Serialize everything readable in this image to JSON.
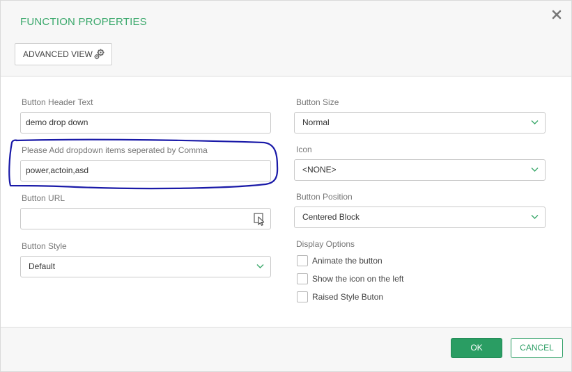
{
  "dialog": {
    "title": "FUNCTION PROPERTIES",
    "advanced_view_label": "ADVANCED VIEW"
  },
  "fields": {
    "button_header_text": {
      "label": "Button Header Text",
      "value": "demo drop down"
    },
    "dropdown_items": {
      "label": "Please Add dropdown items seperated by Comma",
      "value": "power,actoin,asd"
    },
    "button_url": {
      "label": "Button URL",
      "value": ""
    },
    "button_style": {
      "label": "Button Style",
      "value": "Default"
    },
    "button_size": {
      "label": "Button Size",
      "value": "Normal"
    },
    "icon": {
      "label": "Icon",
      "value": "<NONE>"
    },
    "button_position": {
      "label": "Button Position",
      "value": "Centered Block"
    }
  },
  "display_options": {
    "label": "Display Options",
    "items": [
      {
        "label": "Animate the button",
        "checked": false
      },
      {
        "label": "Show the icon on the left",
        "checked": false
      },
      {
        "label": "Raised Style Buton",
        "checked": false
      }
    ]
  },
  "footer": {
    "ok_label": "OK",
    "cancel_label": "CANCEL"
  },
  "colors": {
    "accent": "#2a9d63",
    "title": "#3aa86b",
    "annotation": "#1a1aa8"
  },
  "icons": [
    "close-icon",
    "gear-icon",
    "chevron-down-icon",
    "file-pointer-icon"
  ]
}
